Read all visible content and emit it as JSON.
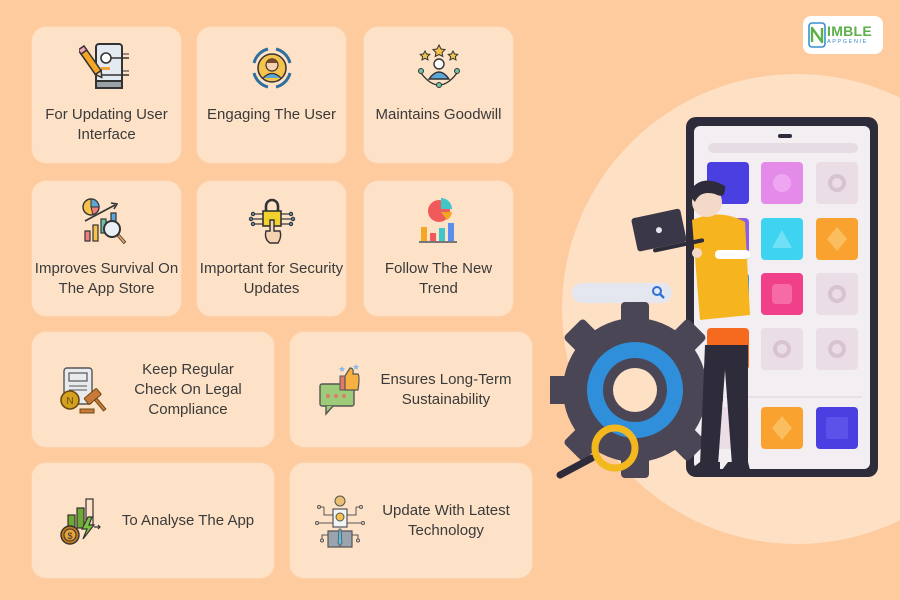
{
  "brand": {
    "logo_main": "IMBLE",
    "logo_sub": "APPGENIE",
    "logo_initial_icon": "phone-n-logo-icon",
    "colors": {
      "green": "#5BB04A",
      "blue": "#3A8FD0"
    }
  },
  "theme": {
    "background": "#FDCB9E",
    "card": "#FEE2C8",
    "accent_circle": "#FEE0C4"
  },
  "cards": [
    {
      "label": "For Updating User Interface",
      "icon": "mobile-ui-edit-icon"
    },
    {
      "label": "Engaging The User",
      "icon": "user-engagement-icon"
    },
    {
      "label": "Maintains Goodwill",
      "icon": "user-stars-icon"
    },
    {
      "label": "Improves Survival On The App Store",
      "icon": "analytics-search-icon"
    },
    {
      "label": "Important for Security Updates",
      "icon": "security-lock-icon"
    },
    {
      "label": "Follow The New Trend",
      "icon": "trend-chart-icon"
    },
    {
      "label": "Keep Regular Check On Legal Compliance",
      "icon": "legal-document-gavel-icon"
    },
    {
      "label": "Ensures Long-Term Sustainability",
      "icon": "thumbs-up-feedback-icon"
    },
    {
      "label": "To Analyse The App",
      "icon": "revenue-growth-icon"
    },
    {
      "label": "Update With Latest Technology",
      "icon": "tech-person-icon"
    }
  ],
  "illustration": {
    "name": "developer-with-phone-illustration",
    "elements": [
      "phone-mockup",
      "app-tiles",
      "person-with-laptop",
      "search-bar",
      "gear",
      "magnifier"
    ]
  }
}
